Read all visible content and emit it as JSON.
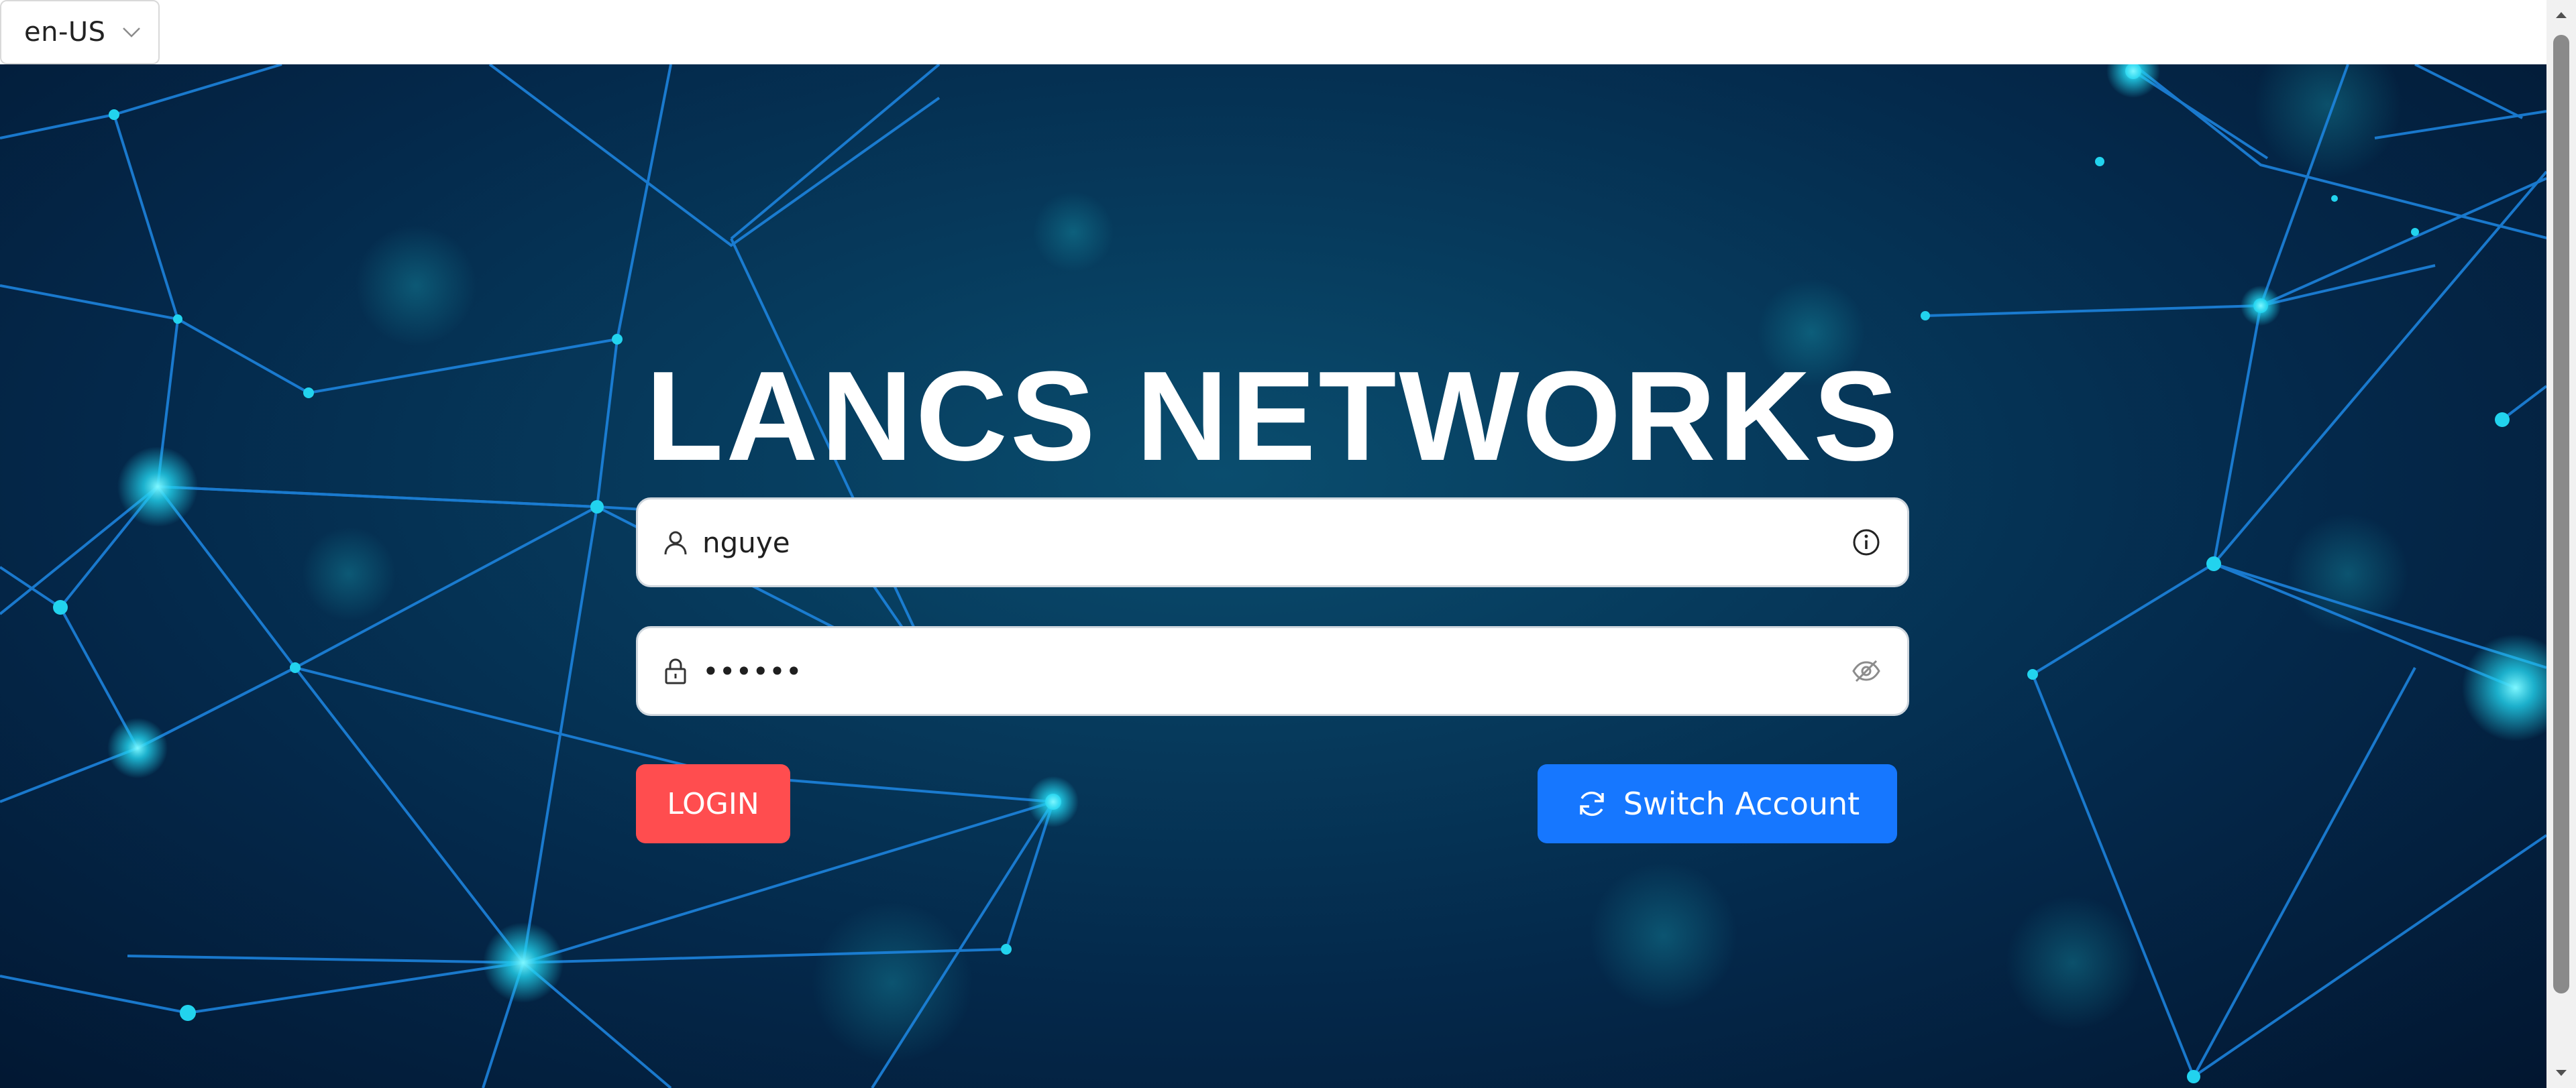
{
  "language_select": {
    "value": "en-US",
    "icon": "chevron-down-icon"
  },
  "brand": {
    "title": "LANCS NETWORKS"
  },
  "login_form": {
    "username": {
      "value": "nguye",
      "prefix_icon": "user-icon",
      "suffix_icon": "info-circle-icon"
    },
    "password": {
      "value": "••••••",
      "prefix_icon": "lock-icon",
      "suffix_icon": "eye-invisible-icon"
    },
    "login_label": "LOGIN",
    "switch_account_label": "Switch Account",
    "switch_account_icon": "sync-icon"
  },
  "colors": {
    "login_button": "#ff4d4f",
    "switch_button": "#1677ff",
    "background": "#04284a",
    "network_lines": "#1e88e5",
    "network_nodes": "#22d3ee"
  }
}
